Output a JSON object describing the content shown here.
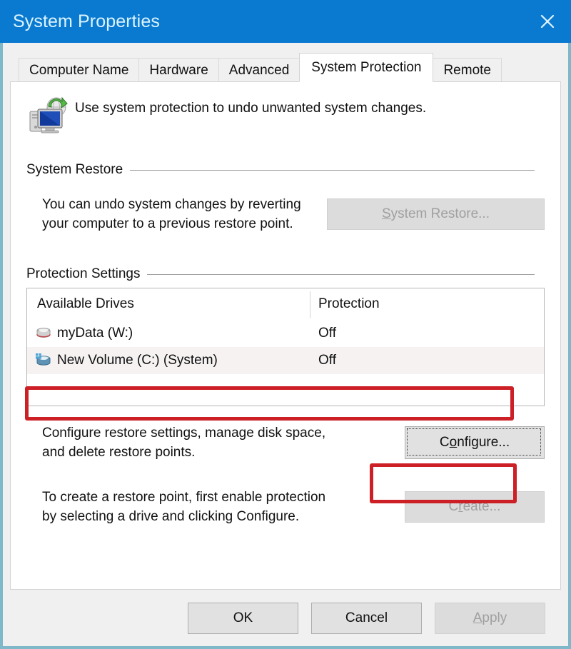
{
  "window": {
    "title": "System Properties",
    "close_icon": "close-icon",
    "accent_color": "#0a7ad1",
    "frame_color": "#7fb8c9"
  },
  "tabs": [
    {
      "label": "Computer Name",
      "active": false
    },
    {
      "label": "Hardware",
      "active": false
    },
    {
      "label": "Advanced",
      "active": false
    },
    {
      "label": "System Protection",
      "active": true
    },
    {
      "label": "Remote",
      "active": false
    }
  ],
  "header": {
    "icon": "system-protection-icon",
    "description": "Use system protection to undo unwanted system changes."
  },
  "system_restore": {
    "group_title": "System Restore",
    "description_line1": "You can undo system changes by reverting",
    "description_line2": "your computer to a previous restore point.",
    "button_label": "System Restore...",
    "button_accel": "S",
    "button_rest": "ystem Restore...",
    "button_disabled": true
  },
  "protection_settings": {
    "group_title": "Protection Settings",
    "columns": [
      "Available Drives",
      "Protection"
    ],
    "rows": [
      {
        "drive": "myData (W:)",
        "protection": "Off",
        "icon": "hard-drive-icon",
        "selected": false
      },
      {
        "drive": "New Volume (C:) (System)",
        "protection": "Off",
        "icon": "system-drive-icon",
        "selected": true
      }
    ]
  },
  "configure": {
    "description_line1": "Configure restore settings, manage disk space,",
    "description_line2": "and delete restore points.",
    "button_prefix": "C",
    "button_accel": "o",
    "button_suffix": "nfigure...",
    "button_label": "Configure...",
    "focused": true
  },
  "create": {
    "description_line1": "To create a restore point, first enable protection",
    "description_line2": "by selecting a drive and clicking Configure.",
    "button_prefix": "C",
    "button_accel": "r",
    "button_suffix": "eate...",
    "button_label": "Create...",
    "button_disabled": true
  },
  "footer": {
    "ok_label": "OK",
    "cancel_label": "Cancel",
    "apply_label": "Apply",
    "apply_disabled": true
  },
  "annotations": {
    "highlight_color": "#cc2026",
    "items": [
      {
        "target": "selected-drive-row",
        "shape": "rectangle"
      },
      {
        "target": "configure-button",
        "shape": "rectangle"
      }
    ]
  }
}
